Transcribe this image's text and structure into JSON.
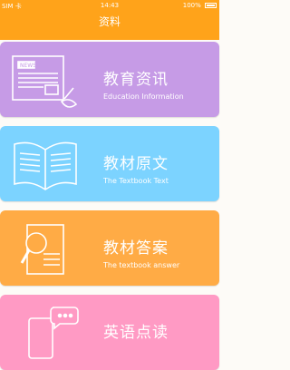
{
  "status_bar": {
    "carrier": "SIM 卡",
    "time": "14:43",
    "battery": "100%"
  },
  "header": {
    "title": "资料"
  },
  "cards": [
    {
      "title": "教育资讯",
      "subtitle": "Education Information",
      "color": "#c69be6",
      "icon": "newspaper-icon"
    },
    {
      "title": "教材原文",
      "subtitle": "The Textbook Text",
      "color": "#7cd3ff",
      "icon": "open-book-icon"
    },
    {
      "title": "教材答案",
      "subtitle": "The textbook answer",
      "color": "#ffab45",
      "icon": "magnifier-document-icon"
    },
    {
      "title": "英语点读",
      "subtitle": "",
      "color": "#ff9ac4",
      "icon": "phone-chat-icon"
    }
  ]
}
